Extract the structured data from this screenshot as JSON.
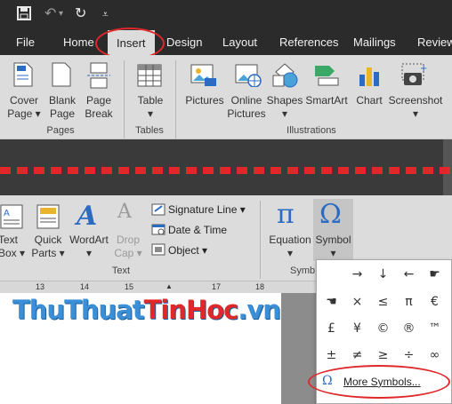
{
  "qat": {
    "save_icon": "save-icon",
    "undo_icon": "undo-icon",
    "redo_icon": "redo-icon",
    "customize_icon": "customize-qat-icon"
  },
  "tabs": [
    "File",
    "Home",
    "Insert",
    "Design",
    "Layout",
    "References",
    "Mailings",
    "Review"
  ],
  "active_tab": "Insert",
  "ribbon_top": {
    "pages": {
      "cover_page": "Cover\nPage ▾",
      "blank_page": "Blank\nPage",
      "page_break": "Page\nBreak",
      "group": "Pages"
    },
    "tables": {
      "table": "Table\n▾",
      "group": "Tables"
    },
    "illustrations": {
      "pictures": "Pictures",
      "online_pictures": "Online\nPictures",
      "shapes": "Shapes\n▾",
      "smartart": "SmartArt",
      "chart": "Chart",
      "screenshot": "Screenshot\n▾",
      "group": "Illustrations"
    }
  },
  "ribbon_bottom": {
    "text_box": "Text\nBox ▾",
    "quick_parts": "Quick\nParts ▾",
    "wordart": "WordArt\n▾",
    "drop_cap": "Drop\nCap ▾",
    "signature_line": "Signature Line  ▾",
    "date_time": "Date & Time",
    "object": "Object  ▾",
    "text_group": "Text",
    "equation": "Equation\n▾",
    "symbol": "Symbol\n▾",
    "symbols_group": "Symb"
  },
  "ruler": [
    "13",
    "14",
    "15",
    "17",
    "18"
  ],
  "watermark": {
    "part1": "ThuThuat",
    "part2": "TinHoc",
    "part3": ".vn"
  },
  "symbols": [
    "→",
    "↓",
    "←",
    "☛",
    "☚",
    "×",
    "≤",
    "π",
    "€",
    "£",
    "¥",
    "©",
    "®",
    "™",
    "±",
    "≠",
    "≥",
    "÷",
    "∞"
  ],
  "more_symbols": "More Symbols...",
  "colors": {
    "accent": "#e0282a",
    "ribbon": "#dcdcdc",
    "titlebar": "#2b2b2b",
    "watermark": "#3b8fd6"
  }
}
